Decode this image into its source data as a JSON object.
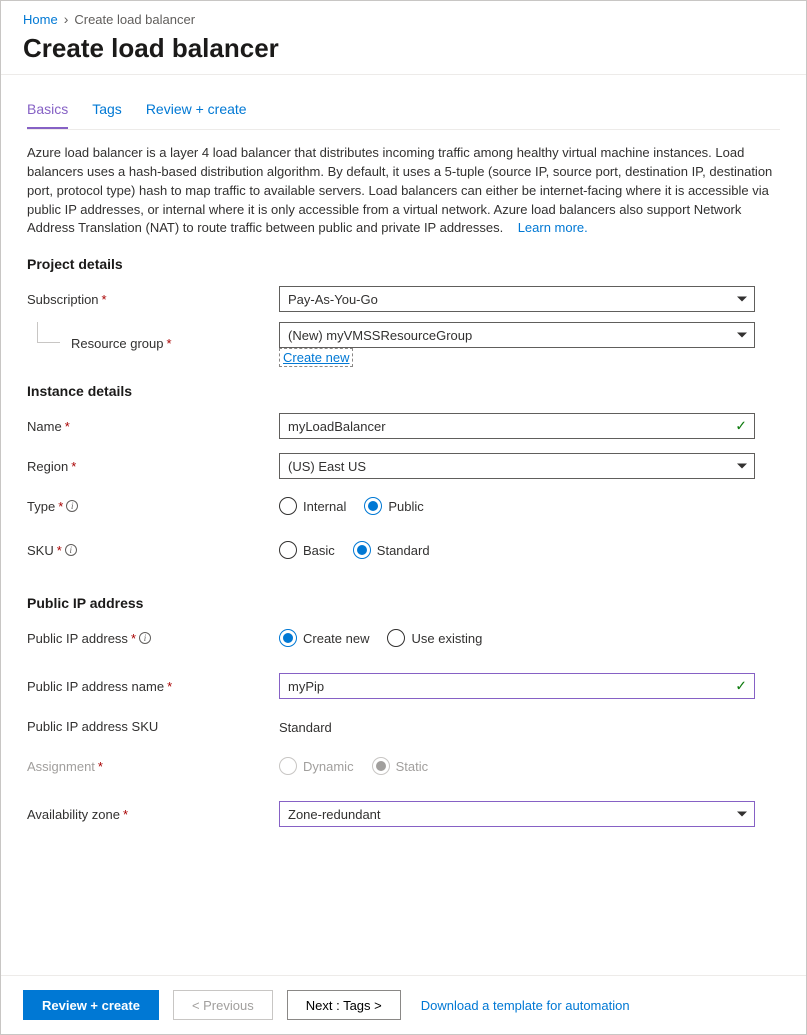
{
  "breadcrumb": {
    "home": "Home",
    "current": "Create load balancer"
  },
  "page_title": "Create load balancer",
  "tabs": {
    "basics": "Basics",
    "tags": "Tags",
    "review": "Review + create"
  },
  "description": "Azure load balancer is a layer 4 load balancer that distributes incoming traffic among healthy virtual machine instances. Load balancers uses a hash-based distribution algorithm. By default, it uses a 5-tuple (source IP, source port, destination IP, destination port, protocol type) hash to map traffic to available servers. Load balancers can either be internet-facing where it is accessible via public IP addresses, or internal where it is only accessible from a virtual network. Azure load balancers also support Network Address Translation (NAT) to route traffic between public and private IP addresses.",
  "learn_more": "Learn more.",
  "sections": {
    "project": "Project details",
    "instance": "Instance details",
    "public_ip": "Public IP address"
  },
  "labels": {
    "subscription": "Subscription",
    "resource_group": "Resource group",
    "create_new": "Create new",
    "name": "Name",
    "region": "Region",
    "type": "Type",
    "sku": "SKU",
    "public_ip_address": "Public IP address",
    "public_ip_name": "Public IP address name",
    "public_ip_sku": "Public IP address SKU",
    "assignment": "Assignment",
    "availability_zone": "Availability zone"
  },
  "values": {
    "subscription": "Pay-As-You-Go",
    "resource_group": "(New) myVMSSResourceGroup",
    "name": "myLoadBalancer",
    "region": "(US) East US",
    "public_ip_name": "myPip",
    "public_ip_sku": "Standard",
    "availability_zone": "Zone-redundant"
  },
  "radios": {
    "type_internal": "Internal",
    "type_public": "Public",
    "sku_basic": "Basic",
    "sku_standard": "Standard",
    "pip_create": "Create new",
    "pip_existing": "Use existing",
    "assign_dynamic": "Dynamic",
    "assign_static": "Static"
  },
  "footer": {
    "review": "Review + create",
    "previous": "< Previous",
    "next": "Next : Tags >",
    "download": "Download a template for automation"
  }
}
